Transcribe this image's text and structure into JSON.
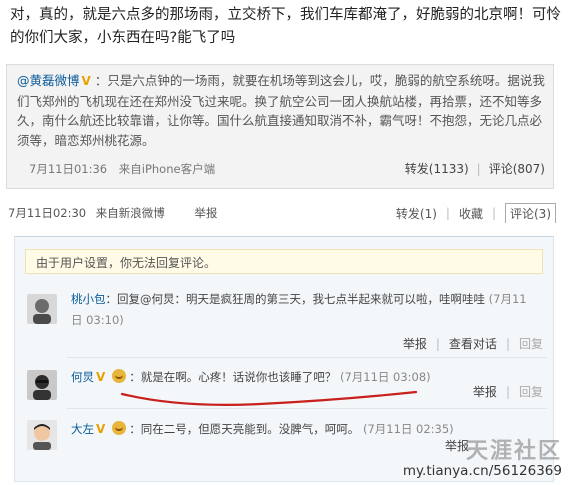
{
  "post": {
    "text": "对，真的，就是六点多的那场雨，立交桥下，我们车库都淹了，好脆弱的北京啊！可怜的你们大家，小东西在吗?能飞了吗"
  },
  "repost": {
    "author": "@黄磊微博",
    "verified_badge": "V",
    "text": "：只是六点钟的一场雨，就要在机场等到这会儿，哎，脆弱的航空系统呀。据说我们飞郑州的飞机现在还在郑州没飞过来呢。换了航空公司一团人换航站楼，再拾票，还不知等多久，南什么航还比较靠谱，让你等。国什么航直接通知取消不补，霸气呀！不抱怨，无论几点必须等，暗恋郑州桃花源。",
    "time": "7月11日01:36",
    "source": "来自iPhone客户端",
    "repost_label": "转发(1133)",
    "comment_label": "评论(807)"
  },
  "post_meta": {
    "time": "7月11日02:30",
    "source": "来自新浪微博",
    "report": "举报",
    "repost_label": "转发(1)",
    "favorite_label": "收藏",
    "comment_label": "评论(3)"
  },
  "comments": {
    "notice": "由于用户设置，你无法回复评论。",
    "items": [
      {
        "name": "桃小包",
        "text": "：回复@何炅：明天是疯狂周的第三天，我七点半起来就可以啦，哇啊哇哇",
        "time": "(7月11日 03:10)",
        "report": "举报",
        "view_dialog": "查看对话",
        "reply": "回复"
      },
      {
        "name": "何炅",
        "text": "：就是在啊。心疼！话说你也该睡了吧？",
        "time": "(7月11日 03:08)",
        "report": "举报",
        "reply": "回复"
      },
      {
        "name": "大左",
        "text": "：同在二号，但愿天亮能到。没脾气，呵呵。",
        "time": "(7月11日 02:35)",
        "report": "举报"
      }
    ]
  },
  "watermark": {
    "logo_text": "天涯社区",
    "url": "my.tianya.cn/56126369"
  },
  "colors": {
    "link": "#0a5b99",
    "badge": "#e8a100",
    "underline": "#c8201c"
  }
}
